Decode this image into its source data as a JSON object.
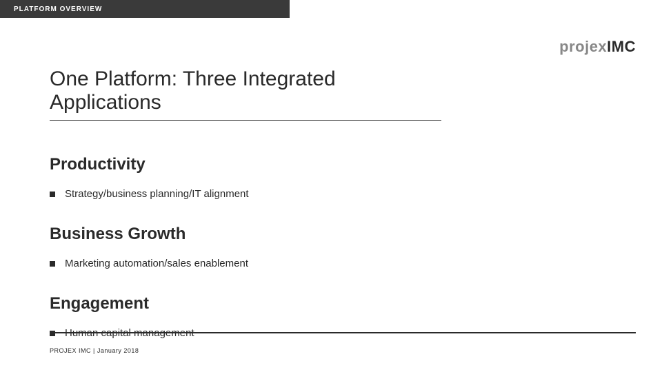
{
  "header": {
    "label": "PLATFORM OVERVIEW"
  },
  "logo": {
    "part1": "projex",
    "part2": "IMC"
  },
  "title": "One Platform: Three Integrated Applications",
  "sections": [
    {
      "heading": "Productivity",
      "bullet": "Strategy/business planning/IT alignment"
    },
    {
      "heading": "Business Growth",
      "bullet": "Marketing automation/sales enablement"
    },
    {
      "heading": "Engagement",
      "bullet": "Human capital management"
    }
  ],
  "footer": "PROJEX IMC  |  January 2018"
}
